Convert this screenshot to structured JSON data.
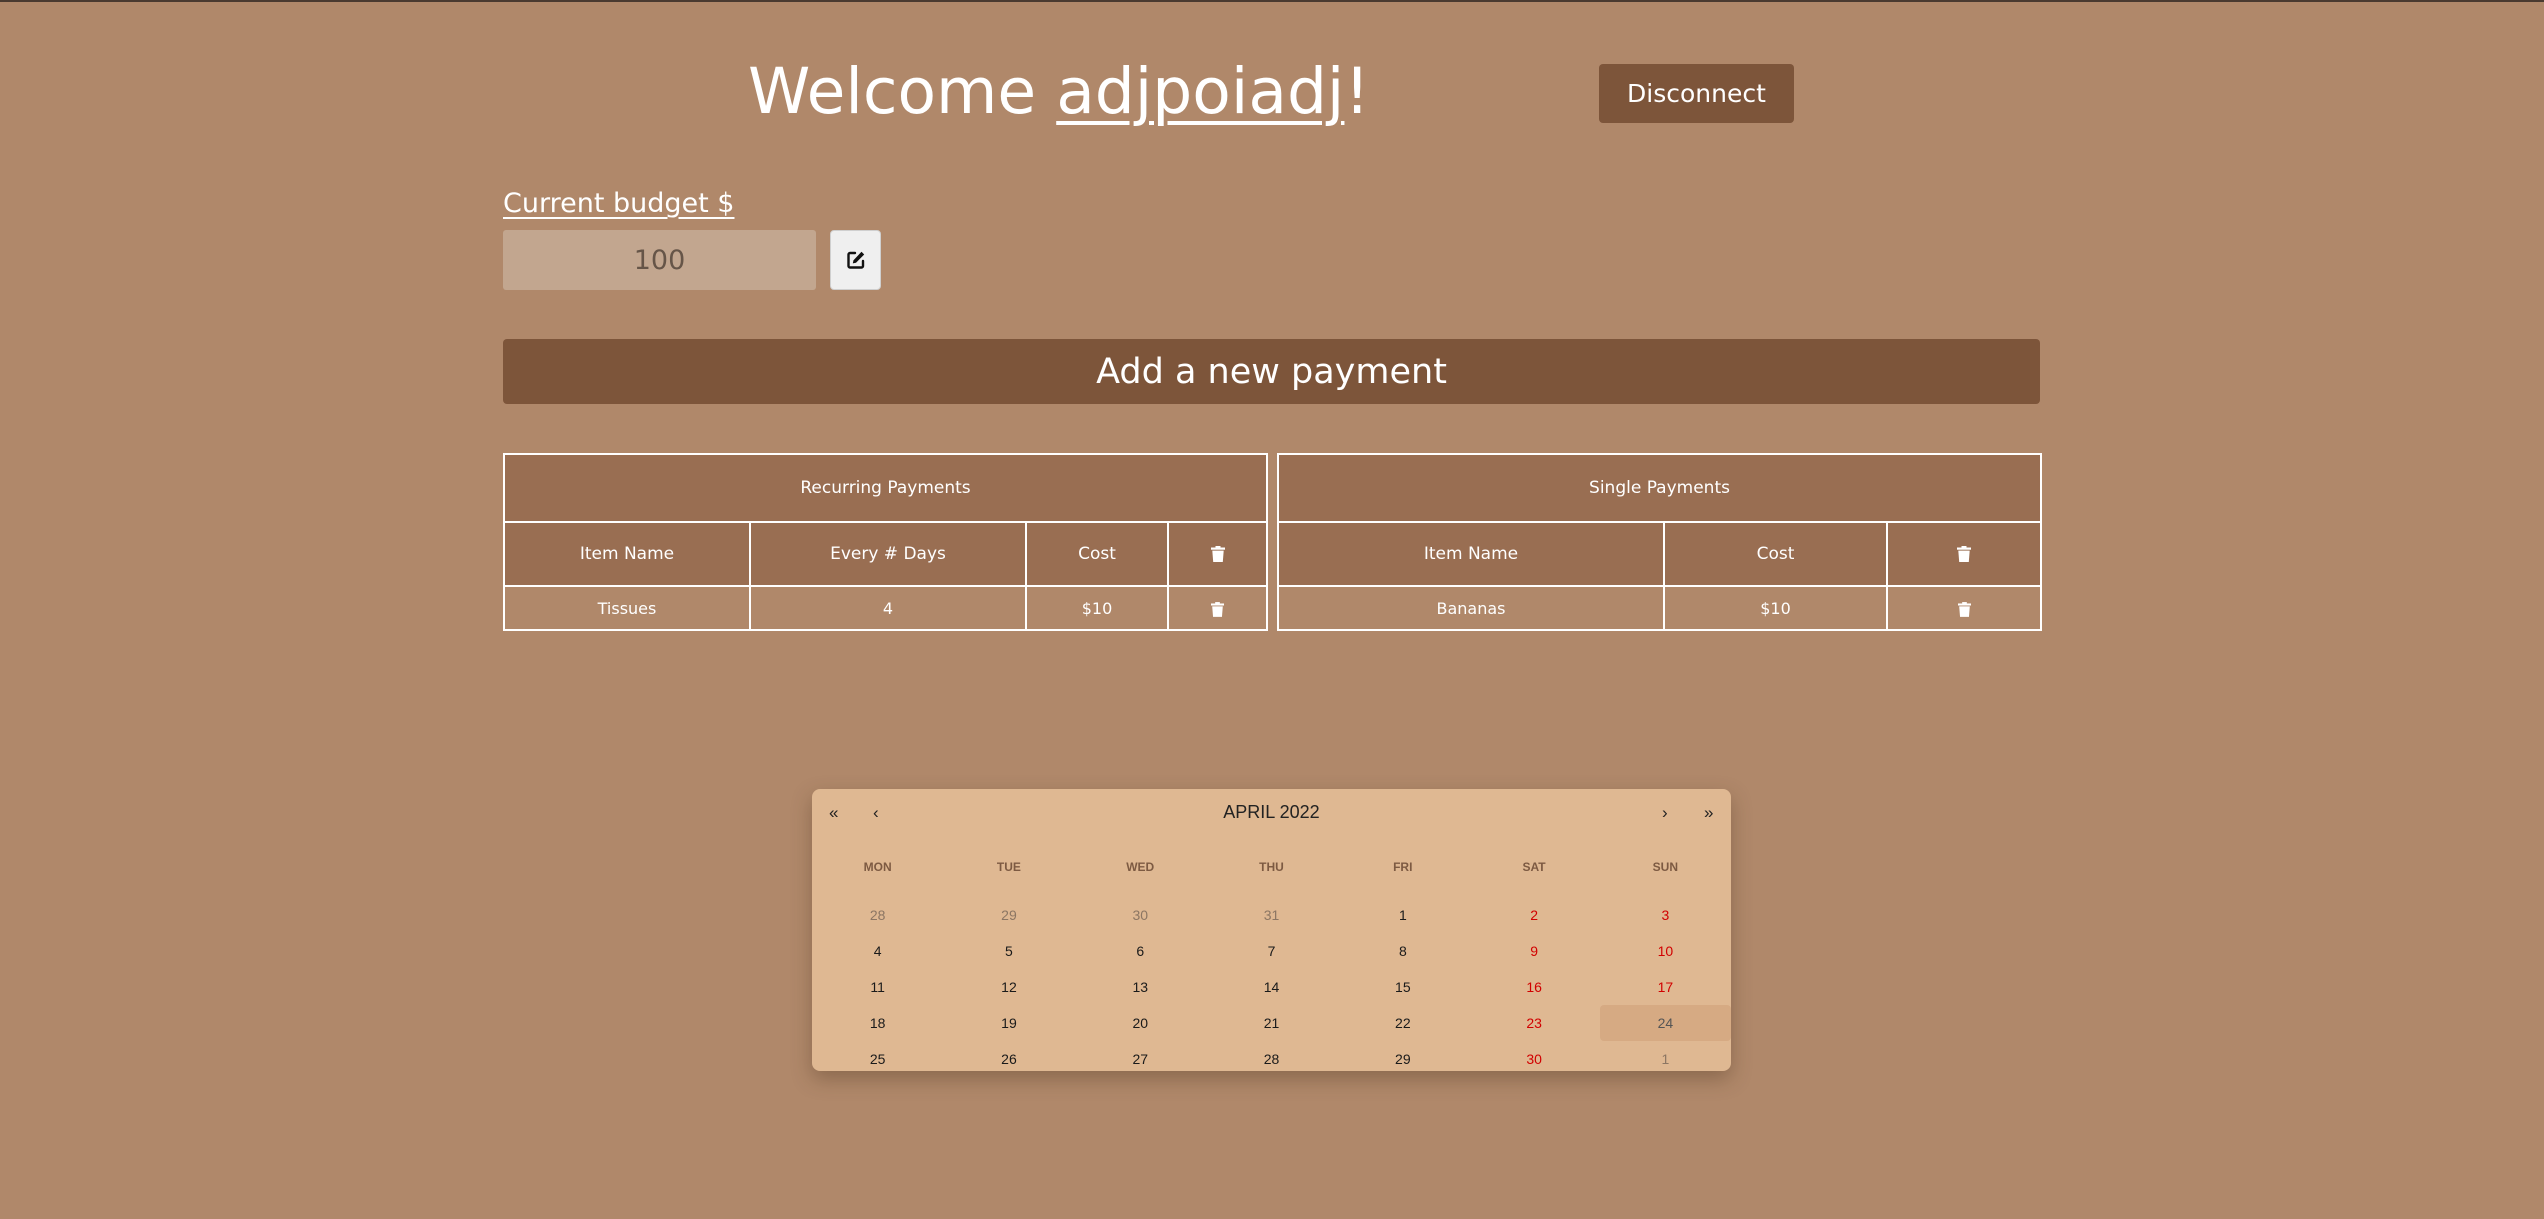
{
  "header": {
    "welcome_prefix": "Welcome ",
    "username": "adjpoiadj",
    "welcome_suffix": "!",
    "disconnect_label": "Disconnect"
  },
  "budget": {
    "label": "Current budget $",
    "value": "100",
    "edit_icon": "edit-icon"
  },
  "add_payment_label": "Add a new payment",
  "recurring": {
    "title": "Recurring Payments",
    "columns": [
      "Item Name",
      "Every # Days",
      "Cost"
    ],
    "rows": [
      {
        "name": "Tissues",
        "days": "4",
        "cost": "$10"
      }
    ]
  },
  "single": {
    "title": "Single Payments",
    "columns": [
      "Item Name",
      "Cost"
    ],
    "rows": [
      {
        "name": "Bananas",
        "cost": "$10"
      }
    ]
  },
  "calendar": {
    "title": "APRIL 2022",
    "nav": {
      "prev_year": "«",
      "prev_month": "‹",
      "next_month": "›",
      "next_year": "»"
    },
    "weekdays": [
      "MON",
      "TUE",
      "WED",
      "THU",
      "FRI",
      "SAT",
      "SUN"
    ],
    "weeks": [
      [
        "28",
        "29",
        "30",
        "31",
        "1",
        "2",
        "3"
      ],
      [
        "4",
        "5",
        "6",
        "7",
        "8",
        "9",
        "10"
      ],
      [
        "11",
        "12",
        "13",
        "14",
        "15",
        "16",
        "17"
      ],
      [
        "18",
        "19",
        "20",
        "21",
        "22",
        "23",
        "24"
      ],
      [
        "25",
        "26",
        "27",
        "28",
        "29",
        "30",
        "1"
      ]
    ],
    "today": "24"
  },
  "colors": {
    "background": "#b0886a",
    "accent": "#7d553a",
    "table_header": "#996e52",
    "calendar_bg": "#dfb892",
    "weekend": "#d10000"
  }
}
